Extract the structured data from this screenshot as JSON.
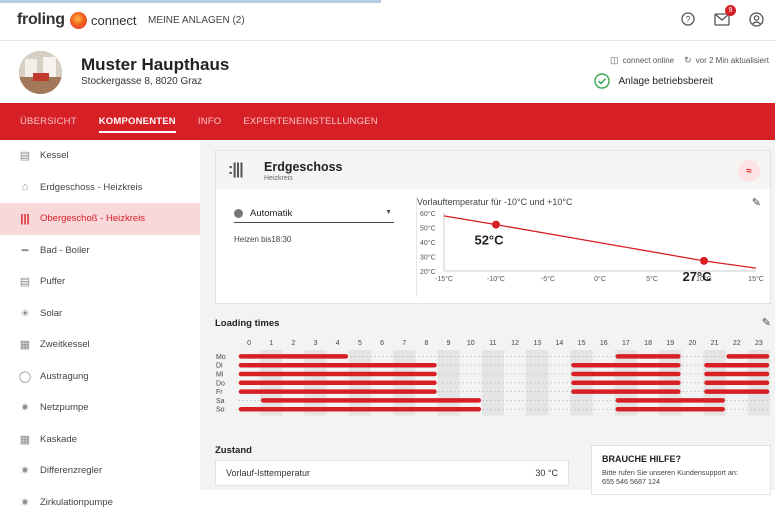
{
  "topbar": {
    "brand": "froling",
    "brand_suffix": "connect",
    "nav_label": "MEINE ANLAGEN (2)",
    "notification_count": "9",
    "icons": [
      "help-icon",
      "mail-icon",
      "user-icon"
    ]
  },
  "header": {
    "title": "Muster Haupthaus",
    "address": "Stockergasse 8, 8020 Graz",
    "connection_status": "connect online",
    "last_update": "vor 2 Min aktualisiert",
    "plant_status": "Anlage betriebsbereit"
  },
  "tabs": [
    {
      "label": "ÜBERSICHT",
      "active": false
    },
    {
      "label": "KOMPONENTEN",
      "active": true
    },
    {
      "label": "INFO",
      "active": false
    },
    {
      "label": "EXPERTENEINSTELLUNGEN",
      "active": false
    }
  ],
  "sidebar": {
    "items": [
      {
        "label": "Kessel",
        "icon": "boiler-icon",
        "active": false
      },
      {
        "label": "Erdgeschoss - Heizkreis",
        "icon": "home-icon",
        "active": false
      },
      {
        "label": "Obergeschoß - Heizkreis",
        "icon": "radiator-icon",
        "active": true
      },
      {
        "label": "Bad - Boiler",
        "icon": "shower-icon",
        "active": false
      },
      {
        "label": "Puffer",
        "icon": "buffer-icon",
        "active": false
      },
      {
        "label": "Solar",
        "icon": "solar-icon",
        "active": false
      },
      {
        "label": "Zweitkessel",
        "icon": "second-boiler-icon",
        "active": false
      },
      {
        "label": "Austragung",
        "icon": "discharge-icon",
        "active": false
      },
      {
        "label": "Netzpumpe",
        "icon": "pump-icon",
        "active": false
      },
      {
        "label": "Kaskade",
        "icon": "cascade-icon",
        "active": false
      },
      {
        "label": "Differenzregler",
        "icon": "differential-icon",
        "active": false
      },
      {
        "label": "Zirkulationpumpe",
        "icon": "circulation-icon",
        "active": false
      }
    ]
  },
  "card": {
    "title": "Erdgeschoss",
    "subtitle": "Heizkreis",
    "mode": "Automatik",
    "heating_until": "Heizen bis18:30"
  },
  "chart_data": {
    "type": "line",
    "title": "Vorlauftemperatur für -10°C und +10°C",
    "x_ticks": [
      "-15°C",
      "-10°C",
      "-5°C",
      "0°C",
      "5°C",
      "10°C",
      "15°C"
    ],
    "y_ticks": [
      "60°C",
      "50°C",
      "40°C",
      "30°C",
      "20°C"
    ],
    "xlim": [
      -15,
      15
    ],
    "ylim": [
      20,
      60
    ],
    "series": [
      {
        "x": [
          -15,
          -10,
          10,
          15
        ],
        "y": [
          58,
          52,
          27,
          22
        ]
      }
    ],
    "points": [
      {
        "x": -10,
        "y": 52,
        "label": "52°C"
      },
      {
        "x": 10,
        "y": 27,
        "label": "27°C"
      }
    ],
    "color": "#d71f26"
  },
  "loading": {
    "title": "Loading times",
    "hours": [
      "0",
      "1",
      "2",
      "3",
      "4",
      "5",
      "6",
      "7",
      "8",
      "9",
      "10",
      "11",
      "12",
      "13",
      "14",
      "15",
      "16",
      "17",
      "18",
      "19",
      "20",
      "21",
      "22",
      "23"
    ],
    "days": [
      {
        "label": "Mo",
        "ranges": [
          [
            0,
            5
          ],
          [
            17,
            20
          ],
          [
            22,
            24
          ]
        ]
      },
      {
        "label": "Di",
        "ranges": [
          [
            0,
            9
          ],
          [
            15,
            20
          ],
          [
            21,
            24
          ]
        ]
      },
      {
        "label": "Mi",
        "ranges": [
          [
            0,
            9
          ],
          [
            15,
            20
          ],
          [
            21,
            24
          ]
        ]
      },
      {
        "label": "Do",
        "ranges": [
          [
            0,
            9
          ],
          [
            15,
            20
          ],
          [
            21,
            24
          ]
        ]
      },
      {
        "label": "Fr",
        "ranges": [
          [
            0,
            9
          ],
          [
            15,
            20
          ],
          [
            21,
            24
          ]
        ]
      },
      {
        "label": "Sa",
        "ranges": [
          [
            1,
            11
          ],
          [
            17,
            22
          ]
        ]
      },
      {
        "label": "So",
        "ranges": [
          [
            0,
            11
          ],
          [
            17,
            22
          ]
        ]
      }
    ]
  },
  "zustand": {
    "title": "Zustand",
    "rows": [
      {
        "label": "Vorlauf-Isttemperatur",
        "value": "30 °C"
      }
    ]
  },
  "help": {
    "title": "BRAUCHE HILFE?",
    "text": "Bitte rufen Sie unseren Kundensupport an:",
    "phone": "655 546 5687 124"
  }
}
